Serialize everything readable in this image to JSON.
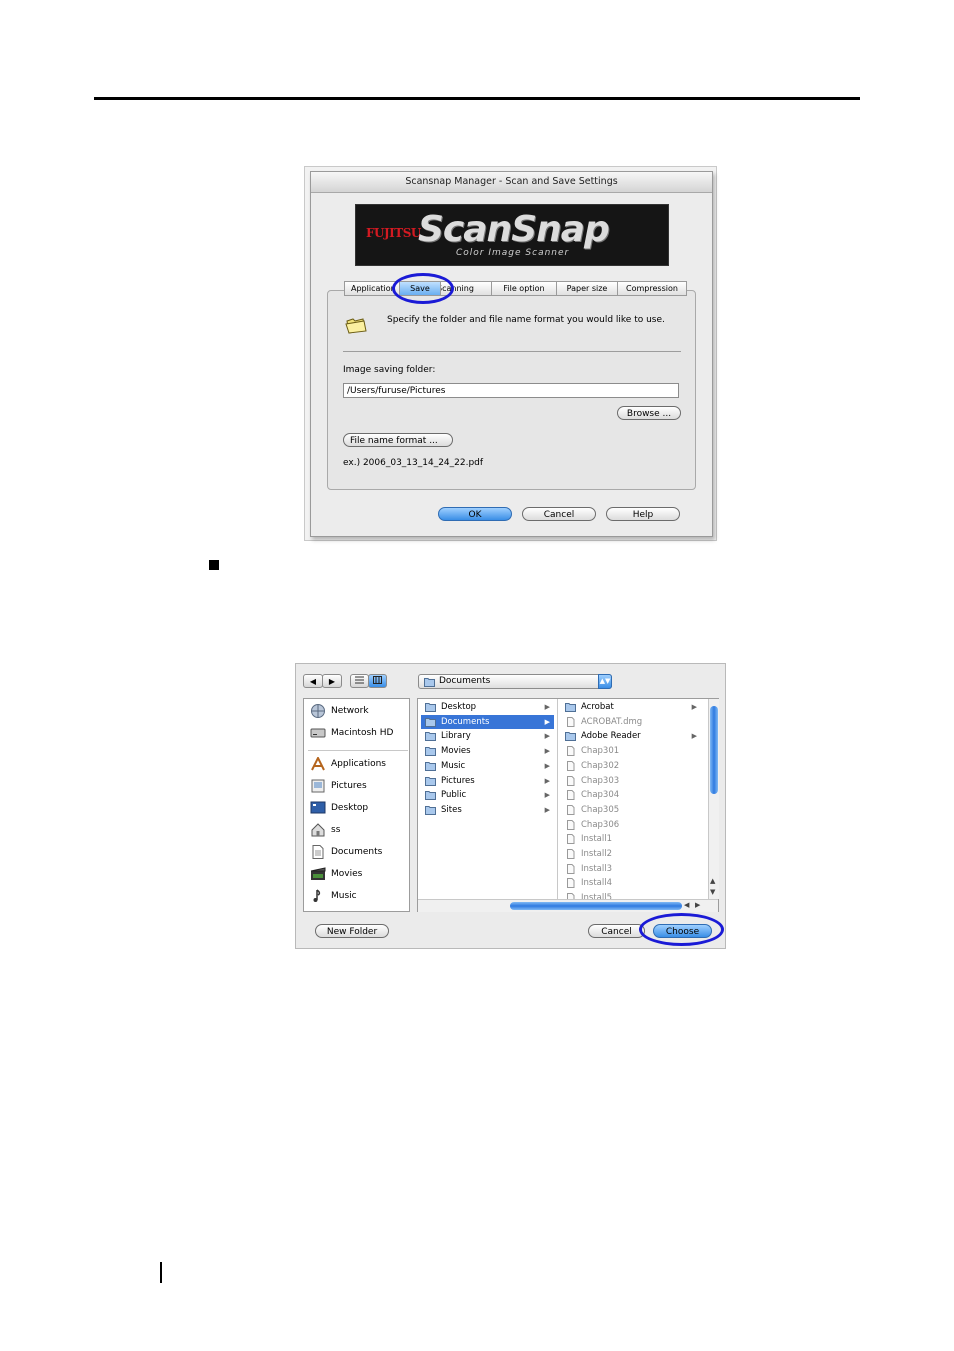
{
  "dialog1": {
    "title": "Scansnap Manager - Scan and Save Settings",
    "brand_logo": "FUJITSU",
    "product_logo": "ScanSnap",
    "product_tagline": "Color Image Scanner",
    "tabs": [
      {
        "label": "Application"
      },
      {
        "label": "Save"
      },
      {
        "label": "Scanning"
      },
      {
        "label": "File option"
      },
      {
        "label": "Paper size"
      },
      {
        "label": "Compression"
      }
    ],
    "selected_tab": "Save",
    "description": "Specify the folder and file name format you would like to use.",
    "folder_label": "Image saving folder:",
    "folder_value": "/Users/furuse/Pictures",
    "browse_label": "Browse ...",
    "file_name_format_label": "File name format ...",
    "example": "ex.) 2006_03_13_14_24_22.pdf",
    "ok_label": "OK",
    "cancel_label": "Cancel",
    "help_label": "Help"
  },
  "dialog2": {
    "back_icon": "◀",
    "forward_icon": "▶",
    "location": "Documents",
    "sidebar": [
      {
        "label": "Network",
        "icon": "network-icon"
      },
      {
        "label": "Macintosh HD",
        "icon": "hard-drive-icon"
      },
      {
        "label": "Applications",
        "icon": "applications-icon"
      },
      {
        "label": "Pictures",
        "icon": "pictures-icon"
      },
      {
        "label": "Desktop",
        "icon": "desktop-icon"
      },
      {
        "label": "ss",
        "icon": "home-icon"
      },
      {
        "label": "Documents",
        "icon": "documents-icon"
      },
      {
        "label": "Movies",
        "icon": "movies-icon"
      },
      {
        "label": "Music",
        "icon": "music-icon"
      }
    ],
    "column1": [
      {
        "label": "Desktop",
        "selected": false
      },
      {
        "label": "Documents",
        "selected": true
      },
      {
        "label": "Library",
        "selected": false
      },
      {
        "label": "Movies",
        "selected": false
      },
      {
        "label": "Music",
        "selected": false
      },
      {
        "label": "Pictures",
        "selected": false
      },
      {
        "label": "Public",
        "selected": false
      },
      {
        "label": "Sites",
        "selected": false
      }
    ],
    "column2": [
      {
        "label": "Acrobat",
        "type": "folder"
      },
      {
        "label": "ACROBAT.dmg",
        "type": "file"
      },
      {
        "label": "Adobe Reader",
        "type": "folder"
      },
      {
        "label": "Chap301",
        "type": "file"
      },
      {
        "label": "Chap302",
        "type": "file"
      },
      {
        "label": "Chap303",
        "type": "file"
      },
      {
        "label": "Chap304",
        "type": "file"
      },
      {
        "label": "Chap305",
        "type": "file"
      },
      {
        "label": "Chap306",
        "type": "file"
      },
      {
        "label": "Install1",
        "type": "file"
      },
      {
        "label": "Install2",
        "type": "file"
      },
      {
        "label": "Install3",
        "type": "file"
      },
      {
        "label": "Install4",
        "type": "file"
      },
      {
        "label": "Install5",
        "type": "file"
      }
    ],
    "new_folder_label": "New Folder",
    "cancel_label": "Cancel",
    "choose_label": "Choose"
  },
  "colors": {
    "annotation": "#1a1ad6",
    "selection": "#3875d7",
    "aqua": "#3a8ee6"
  }
}
